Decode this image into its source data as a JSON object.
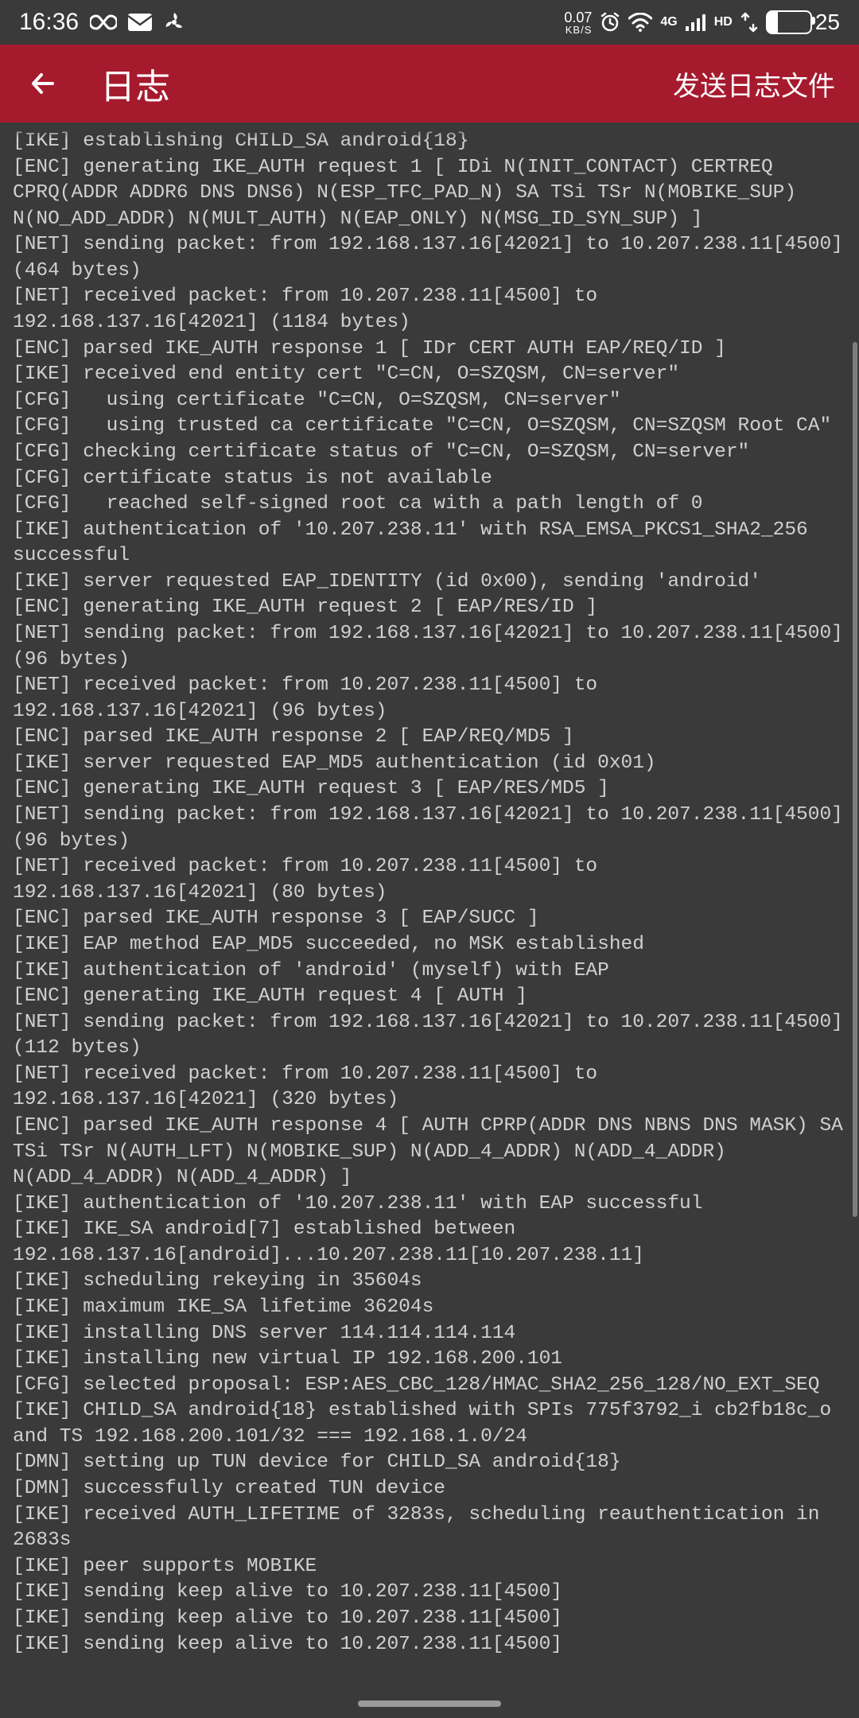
{
  "statusbar": {
    "time": "16:36",
    "net_speed_top": "0.07",
    "net_speed_bot": "KB/S",
    "sig_label_top": "4G",
    "sig_label_bot": "HD",
    "battery_percent": "25"
  },
  "header": {
    "title": "日志",
    "action": "发送日志文件"
  },
  "log_text": "[IKE] establishing CHILD_SA android{18}\n[ENC] generating IKE_AUTH request 1 [ IDi N(INIT_CONTACT) CERTREQ CPRQ(ADDR ADDR6 DNS DNS6) N(ESP_TFC_PAD_N) SA TSi TSr N(MOBIKE_SUP) N(NO_ADD_ADDR) N(MULT_AUTH) N(EAP_ONLY) N(MSG_ID_SYN_SUP) ]\n[NET] sending packet: from 192.168.137.16[42021] to 10.207.238.11[4500] (464 bytes)\n[NET] received packet: from 10.207.238.11[4500] to 192.168.137.16[42021] (1184 bytes)\n[ENC] parsed IKE_AUTH response 1 [ IDr CERT AUTH EAP/REQ/ID ]\n[IKE] received end entity cert \"C=CN, O=SZQSM, CN=server\"\n[CFG]   using certificate \"C=CN, O=SZQSM, CN=server\"\n[CFG]   using trusted ca certificate \"C=CN, O=SZQSM, CN=SZQSM Root CA\"\n[CFG] checking certificate status of \"C=CN, O=SZQSM, CN=server\"\n[CFG] certificate status is not available\n[CFG]   reached self-signed root ca with a path length of 0\n[IKE] authentication of '10.207.238.11' with RSA_EMSA_PKCS1_SHA2_256 successful\n[IKE] server requested EAP_IDENTITY (id 0x00), sending 'android'\n[ENC] generating IKE_AUTH request 2 [ EAP/RES/ID ]\n[NET] sending packet: from 192.168.137.16[42021] to 10.207.238.11[4500] (96 bytes)\n[NET] received packet: from 10.207.238.11[4500] to 192.168.137.16[42021] (96 bytes)\n[ENC] parsed IKE_AUTH response 2 [ EAP/REQ/MD5 ]\n[IKE] server requested EAP_MD5 authentication (id 0x01)\n[ENC] generating IKE_AUTH request 3 [ EAP/RES/MD5 ]\n[NET] sending packet: from 192.168.137.16[42021] to 10.207.238.11[4500] (96 bytes)\n[NET] received packet: from 10.207.238.11[4500] to 192.168.137.16[42021] (80 bytes)\n[ENC] parsed IKE_AUTH response 3 [ EAP/SUCC ]\n[IKE] EAP method EAP_MD5 succeeded, no MSK established\n[IKE] authentication of 'android' (myself) with EAP\n[ENC] generating IKE_AUTH request 4 [ AUTH ]\n[NET] sending packet: from 192.168.137.16[42021] to 10.207.238.11[4500] (112 bytes)\n[NET] received packet: from 10.207.238.11[4500] to 192.168.137.16[42021] (320 bytes)\n[ENC] parsed IKE_AUTH response 4 [ AUTH CPRP(ADDR DNS NBNS DNS MASK) SA TSi TSr N(AUTH_LFT) N(MOBIKE_SUP) N(ADD_4_ADDR) N(ADD_4_ADDR) N(ADD_4_ADDR) N(ADD_4_ADDR) ]\n[IKE] authentication of '10.207.238.11' with EAP successful\n[IKE] IKE_SA android[7] established between 192.168.137.16[android]...10.207.238.11[10.207.238.11]\n[IKE] scheduling rekeying in 35604s\n[IKE] maximum IKE_SA lifetime 36204s\n[IKE] installing DNS server 114.114.114.114\n[IKE] installing new virtual IP 192.168.200.101\n[CFG] selected proposal: ESP:AES_CBC_128/HMAC_SHA2_256_128/NO_EXT_SEQ\n[IKE] CHILD_SA android{18} established with SPIs 775f3792_i cb2fb18c_o and TS 192.168.200.101/32 === 192.168.1.0/24\n[DMN] setting up TUN device for CHILD_SA android{18}\n[DMN] successfully created TUN device\n[IKE] received AUTH_LIFETIME of 3283s, scheduling reauthentication in 2683s\n[IKE] peer supports MOBIKE\n[IKE] sending keep alive to 10.207.238.11[4500]\n[IKE] sending keep alive to 10.207.238.11[4500]\n[IKE] sending keep alive to 10.207.238.11[4500]"
}
